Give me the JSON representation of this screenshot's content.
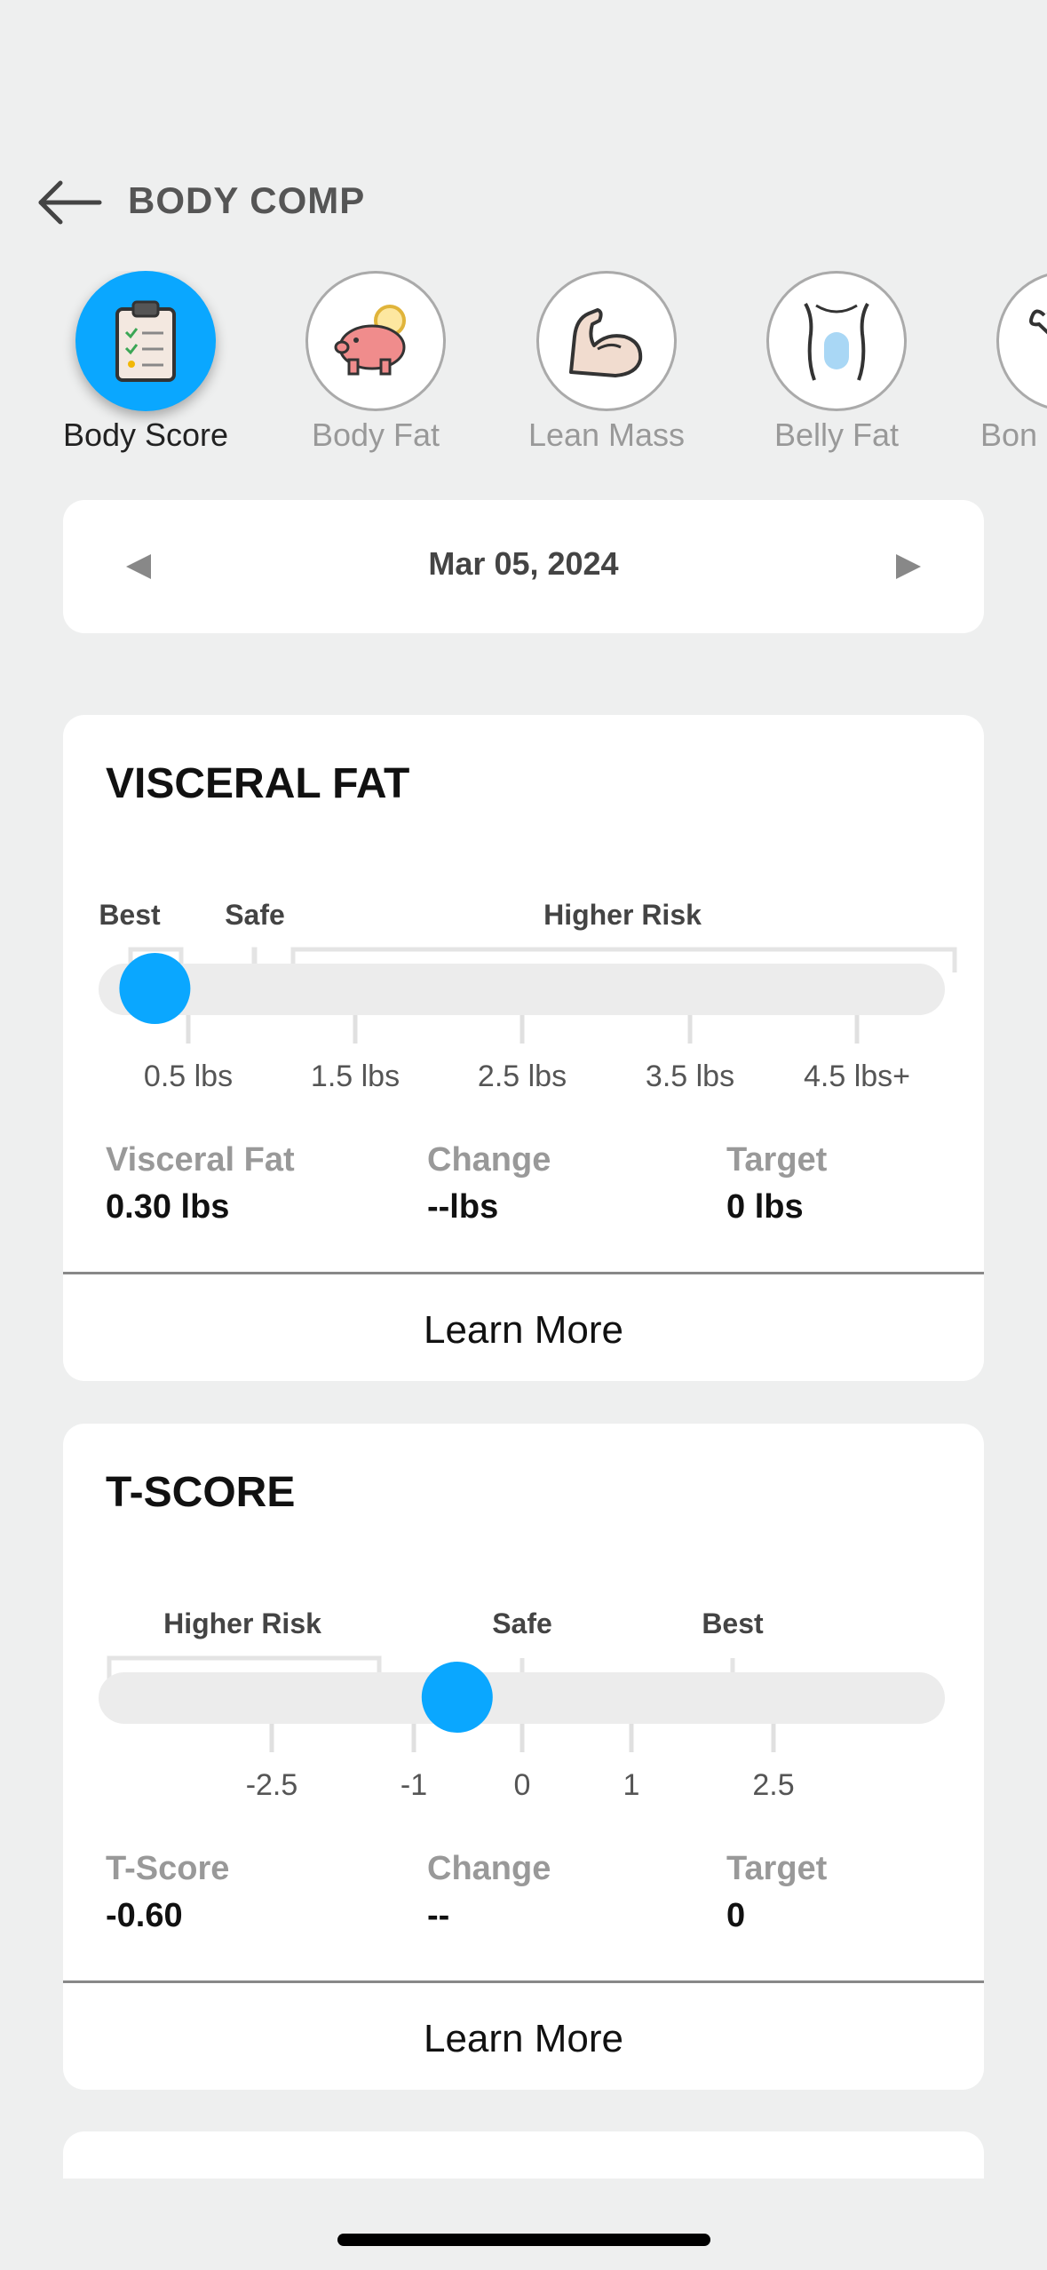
{
  "header": {
    "title": "BODY COMP",
    "back_icon": "arrow-left-icon"
  },
  "categories": [
    {
      "label": "Body Score",
      "icon": "clipboard-checklist-icon",
      "active": true
    },
    {
      "label": "Body Fat",
      "icon": "piggy-bank-icon",
      "active": false
    },
    {
      "label": "Lean Mass",
      "icon": "muscle-arm-icon",
      "active": false
    },
    {
      "label": "Belly Fat",
      "icon": "torso-icon",
      "active": false
    },
    {
      "label": "Bon",
      "icon": "bone-icon",
      "active": false
    }
  ],
  "date_nav": {
    "date": "Mar 05, 2024",
    "prev_icon": "triangle-left-icon",
    "next_icon": "triangle-right-icon"
  },
  "visceral": {
    "title": "VISCERAL FAT",
    "zones": [
      "Best",
      "Safe",
      "Higher Risk"
    ],
    "ticks": [
      "0.5 lbs",
      "1.5 lbs",
      "2.5 lbs",
      "3.5 lbs",
      "4.5 lbs+"
    ],
    "value": 0.3,
    "stats": {
      "value_label": "Visceral Fat",
      "value": "0.30 lbs",
      "change_label": "Change",
      "change": "--lbs",
      "target_label": "Target",
      "target": "0 lbs"
    },
    "learn_more": "Learn More"
  },
  "tscore": {
    "title": "T-SCORE",
    "zones": [
      "Higher Risk",
      "Safe",
      "Best"
    ],
    "ticks": [
      "-2.5",
      "-1",
      "0",
      "1",
      "2.5"
    ],
    "value": -0.6,
    "stats": {
      "value_label": "T-Score",
      "value": "-0.60",
      "change_label": "Change",
      "change": "--",
      "target_label": "Target",
      "target": "0"
    },
    "learn_more": "Learn More"
  },
  "colors": {
    "accent": "#0aa7ff",
    "background": "#eeefef",
    "track": "#ececec"
  }
}
